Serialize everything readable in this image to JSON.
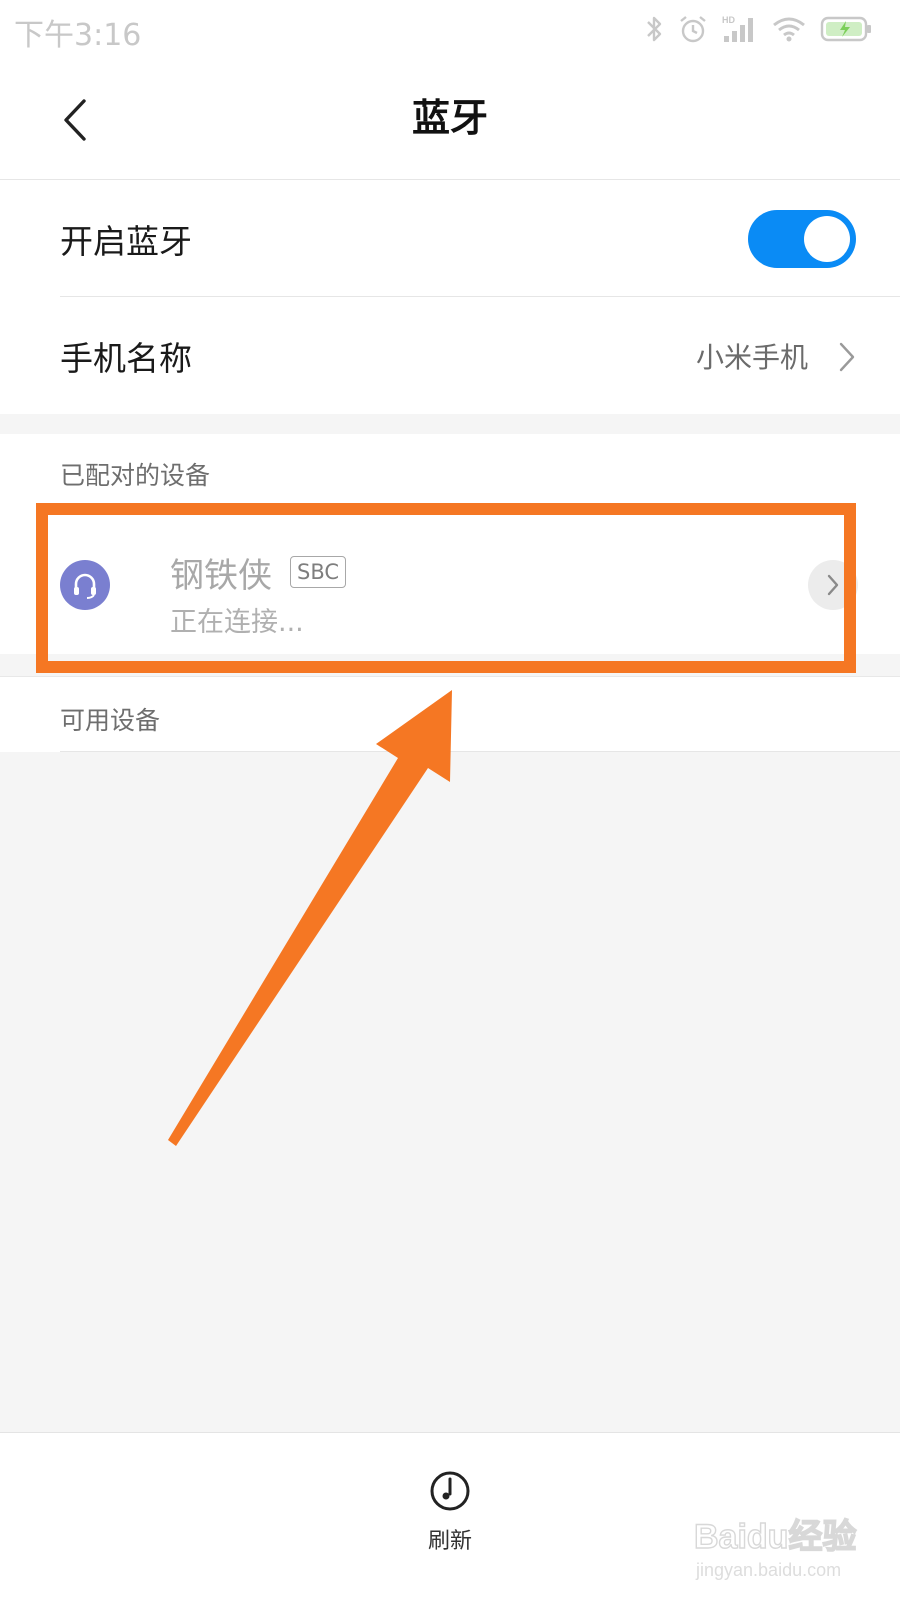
{
  "status_bar": {
    "time": "下午3:16",
    "icons": [
      "bluetooth-icon",
      "alarm-icon",
      "hd-signal-icon",
      "wifi-icon",
      "battery-charging-icon"
    ],
    "network_label": "HD"
  },
  "header": {
    "back_icon": "chevron-left-icon",
    "title": "蓝牙"
  },
  "settings": {
    "bluetooth_toggle_label": "开启蓝牙",
    "bluetooth_enabled": true,
    "accent_color": "#0a8bf5",
    "phone_name_label": "手机名称",
    "phone_name_value": "小米手机"
  },
  "paired_section": {
    "title": "已配对的设备",
    "devices": [
      {
        "icon": "headset-icon",
        "name": "钢铁侠",
        "codec": "SBC",
        "status": "正在连接..."
      }
    ]
  },
  "available_section": {
    "title": "可用设备"
  },
  "bottom_bar": {
    "refresh_icon": "refresh-icon",
    "refresh_label": "刷新"
  },
  "annotation": {
    "highlight_color": "#f57723"
  },
  "watermark": {
    "brand": "Baidu经验",
    "url": "jingyan.baidu.com"
  }
}
